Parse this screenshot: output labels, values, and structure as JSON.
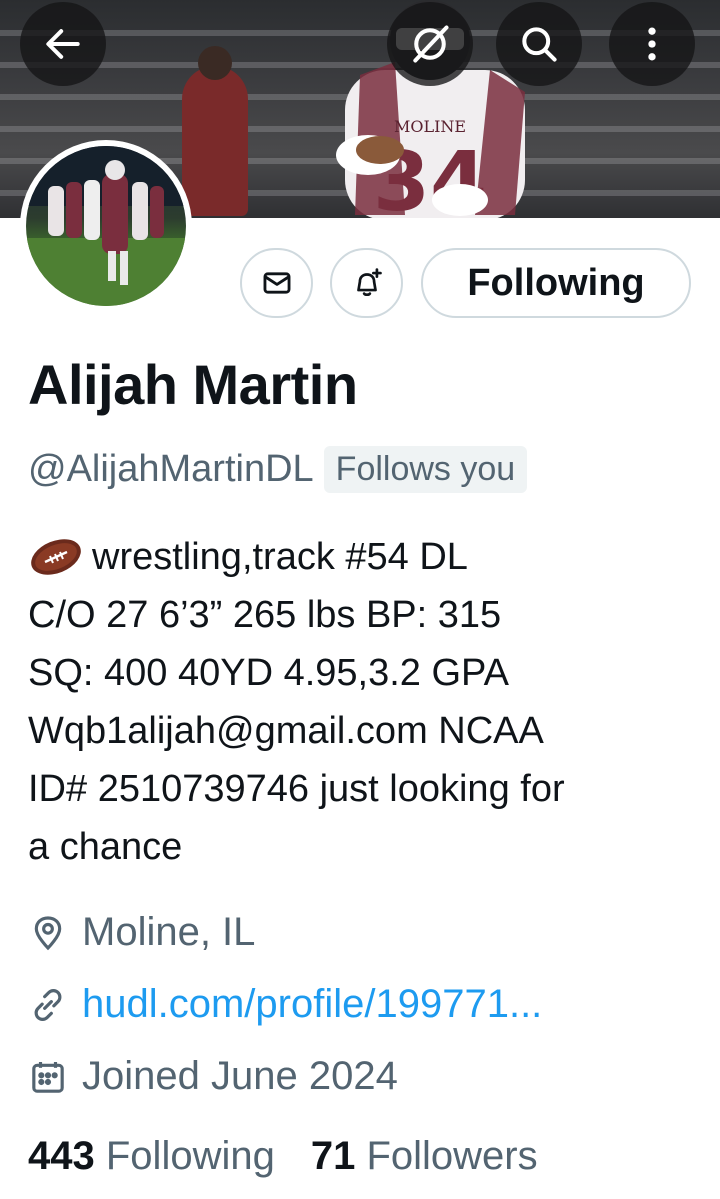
{
  "header": {
    "back_icon": "arrow-left-icon",
    "grok_icon": "grok-icon",
    "search_icon": "search-icon",
    "more_icon": "more-vertical-icon",
    "banner_jersey_text": "MOLINE",
    "banner_jersey_number": "34"
  },
  "actions": {
    "message_icon": "mail-icon",
    "notify_icon": "bell-plus-icon",
    "following_label": "Following"
  },
  "profile": {
    "name": "Alijah Martin",
    "handle": "@AlijahMartinDL",
    "follows_you": "Follows you",
    "bio_emoji": "football-emoji",
    "bio_lines": [
      "wrestling,track  #54 DL",
      "C/O 27 6’3” 265 lbs BP: 315",
      "SQ: 400 40YD 4.95,3.2 GPA",
      "Wqb1alijah@gmail.com NCAA",
      "ID# 2510739746 just looking for",
      "a chance"
    ],
    "location": "Moline, IL",
    "link": "hudl.com/profile/199771...",
    "joined": "Joined June 2024"
  },
  "stats": {
    "following_count": "443",
    "following_label": "Following",
    "followers_count": "71",
    "followers_label": "Followers"
  },
  "colors": {
    "text_primary": "#0f1419",
    "text_secondary": "#536471",
    "link": "#1d9bf0",
    "border": "#cfd9de",
    "jersey_maroon": "#7a2e3e"
  }
}
